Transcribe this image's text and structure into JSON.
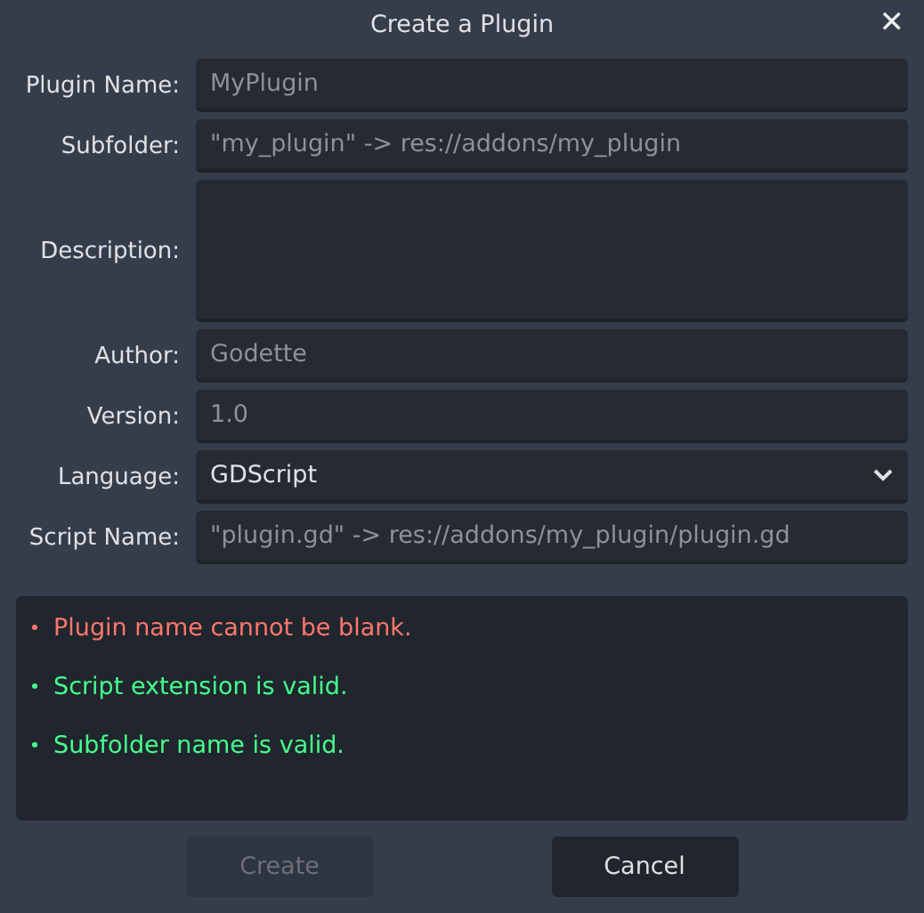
{
  "window": {
    "title": "Create a Plugin",
    "close": "✕"
  },
  "fields": [
    {
      "label": "Plugin Name:",
      "kind": "text",
      "placeholder": "MyPlugin"
    },
    {
      "label": "Subfolder:",
      "kind": "text",
      "placeholder": "\"my_plugin\" -> res://addons/my_plugin"
    },
    {
      "label": "Description:",
      "kind": "textarea"
    },
    {
      "label": "Author:",
      "kind": "text",
      "placeholder": "Godette"
    },
    {
      "label": "Version:",
      "kind": "text",
      "placeholder": "1.0"
    },
    {
      "label": "Language:",
      "kind": "select",
      "value": "GDScript"
    },
    {
      "label": "Script Name:",
      "kind": "text",
      "placeholder": "\"plugin.gd\" -> res://addons/my_plugin/plugin.gd"
    }
  ],
  "messages": [
    {
      "text": "Plugin name cannot be blank.",
      "color": "#ff786b"
    },
    {
      "text": "Script extension is valid.",
      "color": "#45ff8b"
    },
    {
      "text": "Subfolder name is valid.",
      "color": "#45ff8b"
    }
  ],
  "buttons": [
    {
      "label": "Create",
      "disabled": true
    },
    {
      "label": "Cancel",
      "disabled": false
    }
  ]
}
